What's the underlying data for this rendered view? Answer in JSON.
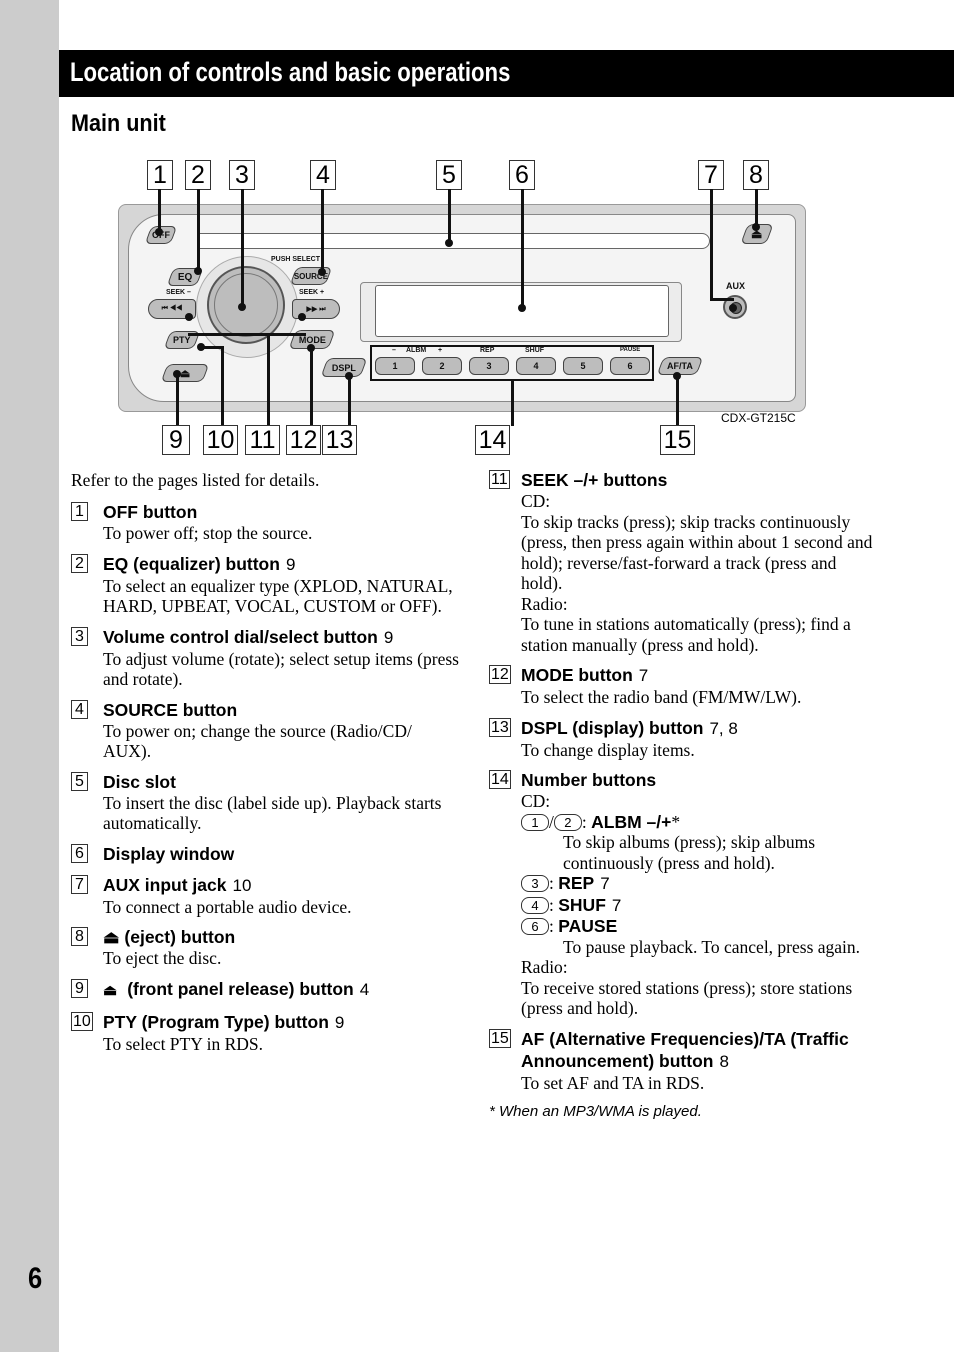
{
  "page": {
    "number": "6",
    "section_title": "Location of controls and basic operations",
    "subtitle": "Main unit",
    "intro": "Refer to the pages listed for details.",
    "footnote": "* When an MP3/WMA is played."
  },
  "figure": {
    "model": "CDX-GT215C",
    "callouts_top": [
      "1",
      "2",
      "3",
      "4",
      "5",
      "6",
      "7",
      "8"
    ],
    "callouts_bottom": [
      "9",
      "10",
      "11",
      "12",
      "13",
      "14",
      "15"
    ],
    "device_labels": {
      "off": "OFF",
      "eq": "EQ",
      "push_select": "PUSH SELECT",
      "source": "SOURCE",
      "seek_minus": "SEEK –",
      "seek_plus": "SEEK +",
      "seek_minus_glyph": "⏮ ◀◀",
      "seek_plus_glyph": "▶▶ ⏭",
      "pty": "PTY",
      "mode": "MODE",
      "release_glyph": "⏏",
      "dspl": "DSPL",
      "aux": "AUX",
      "eject_glyph": "⏏",
      "af_ta": "AF/TA",
      "minus": "–",
      "albm": "ALBM",
      "plus": "+",
      "rep": "REP",
      "shuf": "SHUF",
      "pause": "PAUSE",
      "numbers": [
        "1",
        "2",
        "3",
        "4",
        "5",
        "6"
      ]
    }
  },
  "items": [
    {
      "num": "1",
      "title": "OFF button",
      "ref": "",
      "desc": [
        "To power off; stop the source."
      ]
    },
    {
      "num": "2",
      "title": "EQ (equalizer) button",
      "ref": "9",
      "desc": [
        "To select an equalizer type (XPLOD, NATURAL, HARD, UPBEAT, VOCAL, CUSTOM or OFF)."
      ]
    },
    {
      "num": "3",
      "title": "Volume control dial/select button",
      "ref": "9",
      "desc": [
        "To adjust volume (rotate); select setup items (press and rotate)."
      ]
    },
    {
      "num": "4",
      "title": "SOURCE button",
      "ref": "",
      "desc": [
        "To power on; change the source (Radio/CD/ AUX)."
      ]
    },
    {
      "num": "5",
      "title": "Disc slot",
      "ref": "",
      "desc": [
        "To insert the disc (label side up). Playback starts automatically."
      ]
    },
    {
      "num": "6",
      "title": "Display window",
      "ref": "",
      "desc": []
    },
    {
      "num": "7",
      "title": "AUX input jack",
      "ref": "10",
      "desc": [
        "To connect a portable audio device."
      ]
    },
    {
      "num": "8",
      "title": "⏏ (eject) button",
      "ref": "",
      "desc": [
        "To eject the disc."
      ]
    },
    {
      "num": "9",
      "title": "(front panel release) button",
      "ref": "4",
      "desc": []
    },
    {
      "num": "10",
      "title": "PTY (Program Type) button",
      "ref": "9",
      "desc": [
        "To select PTY in RDS."
      ]
    },
    {
      "num": "11",
      "title": "SEEK –/+ buttons",
      "ref": "",
      "desc": [
        "CD:",
        "To skip tracks (press); skip tracks continuously (press, then press again within about 1 second and hold); reverse/fast-forward a track (press and hold).",
        "Radio:",
        "To tune in stations automatically (press); find a station manually (press and hold)."
      ]
    },
    {
      "num": "12",
      "title": "MODE button",
      "ref": "7",
      "desc": [
        "To select the radio band (FM/MW/LW)."
      ]
    },
    {
      "num": "13",
      "title": "DSPL (display) button",
      "ref": "7, 8",
      "desc": [
        "To change display items."
      ]
    },
    {
      "num": "14",
      "title": "Number buttons",
      "ref": "",
      "desc": [
        "CD:"
      ]
    },
    {
      "num": "15",
      "title": "AF (Alternative Frequencies)/TA (Traffic Announcement) button",
      "ref": "8",
      "desc": [
        "To set AF and TA in RDS."
      ]
    }
  ],
  "number_buttons": {
    "albm": {
      "keys": [
        "1",
        "2"
      ],
      "label": "ALBM –/+",
      "star": "*",
      "desc": "To skip albums (press); skip albums continuously (press and hold)."
    },
    "rep": {
      "key": "3",
      "label": "REP",
      "ref": "7"
    },
    "shuf": {
      "key": "4",
      "label": "SHUF",
      "ref": "7"
    },
    "pause": {
      "key": "6",
      "label": "PAUSE",
      "desc": "To pause playback. To cancel, press again."
    },
    "radio_label": "Radio:",
    "radio_desc": "To receive stored stations (press); store stations (press and hold)."
  }
}
